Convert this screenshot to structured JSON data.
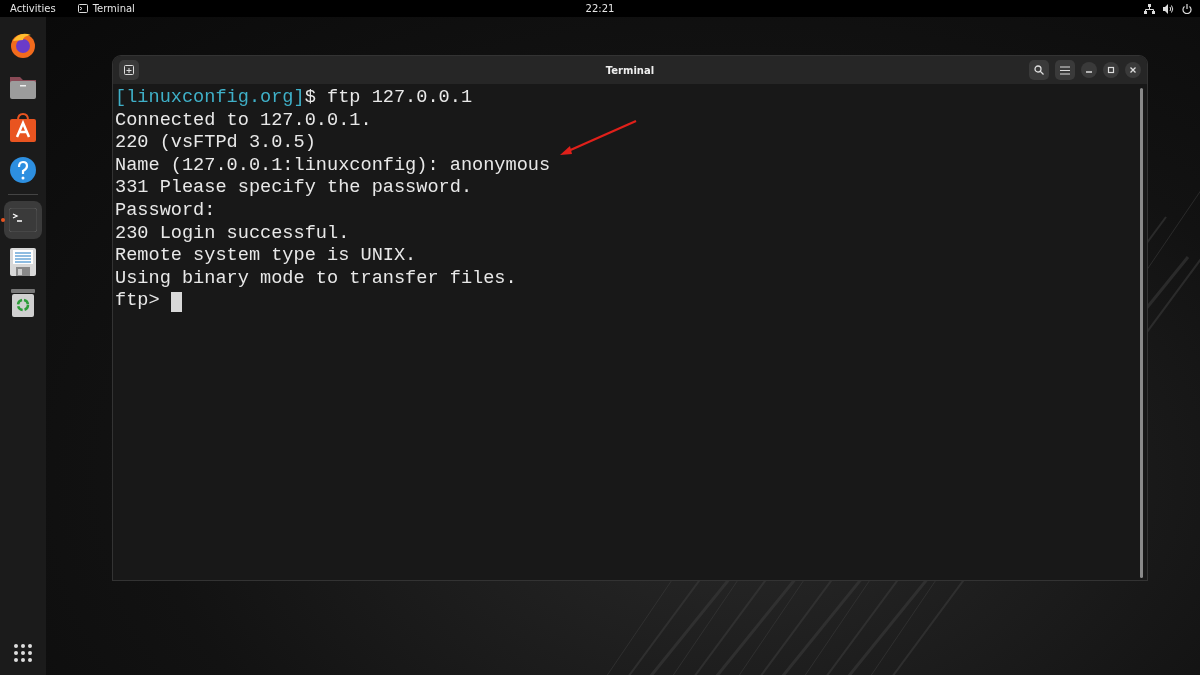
{
  "top_bar": {
    "activities": "Activities",
    "app_name": "Terminal",
    "clock": "22:21"
  },
  "dock": {
    "items": [
      {
        "kind": "browser",
        "running": false
      },
      {
        "kind": "files",
        "running": false
      },
      {
        "kind": "store",
        "running": false
      },
      {
        "kind": "help",
        "running": false
      },
      {
        "kind": "terminal",
        "running": true
      },
      {
        "kind": "writer",
        "running": false
      },
      {
        "kind": "trash",
        "running": false
      }
    ]
  },
  "window": {
    "title": "Terminal",
    "lines": [
      {
        "prompt": "[linuxconfig.org]",
        "text": "$ ftp 127.0.0.1"
      },
      {
        "text": "Connected to 127.0.0.1."
      },
      {
        "text": "220 (vsFTPd 3.0.5)"
      },
      {
        "text": "Name (127.0.0.1:linuxconfig): anonymous"
      },
      {
        "text": "331 Please specify the password."
      },
      {
        "text": "Password:"
      },
      {
        "text": "230 Login successful."
      },
      {
        "text": "Remote system type is UNIX."
      },
      {
        "text": "Using binary mode to transfer files."
      },
      {
        "text": "ftp> ",
        "cursor": true
      }
    ]
  }
}
